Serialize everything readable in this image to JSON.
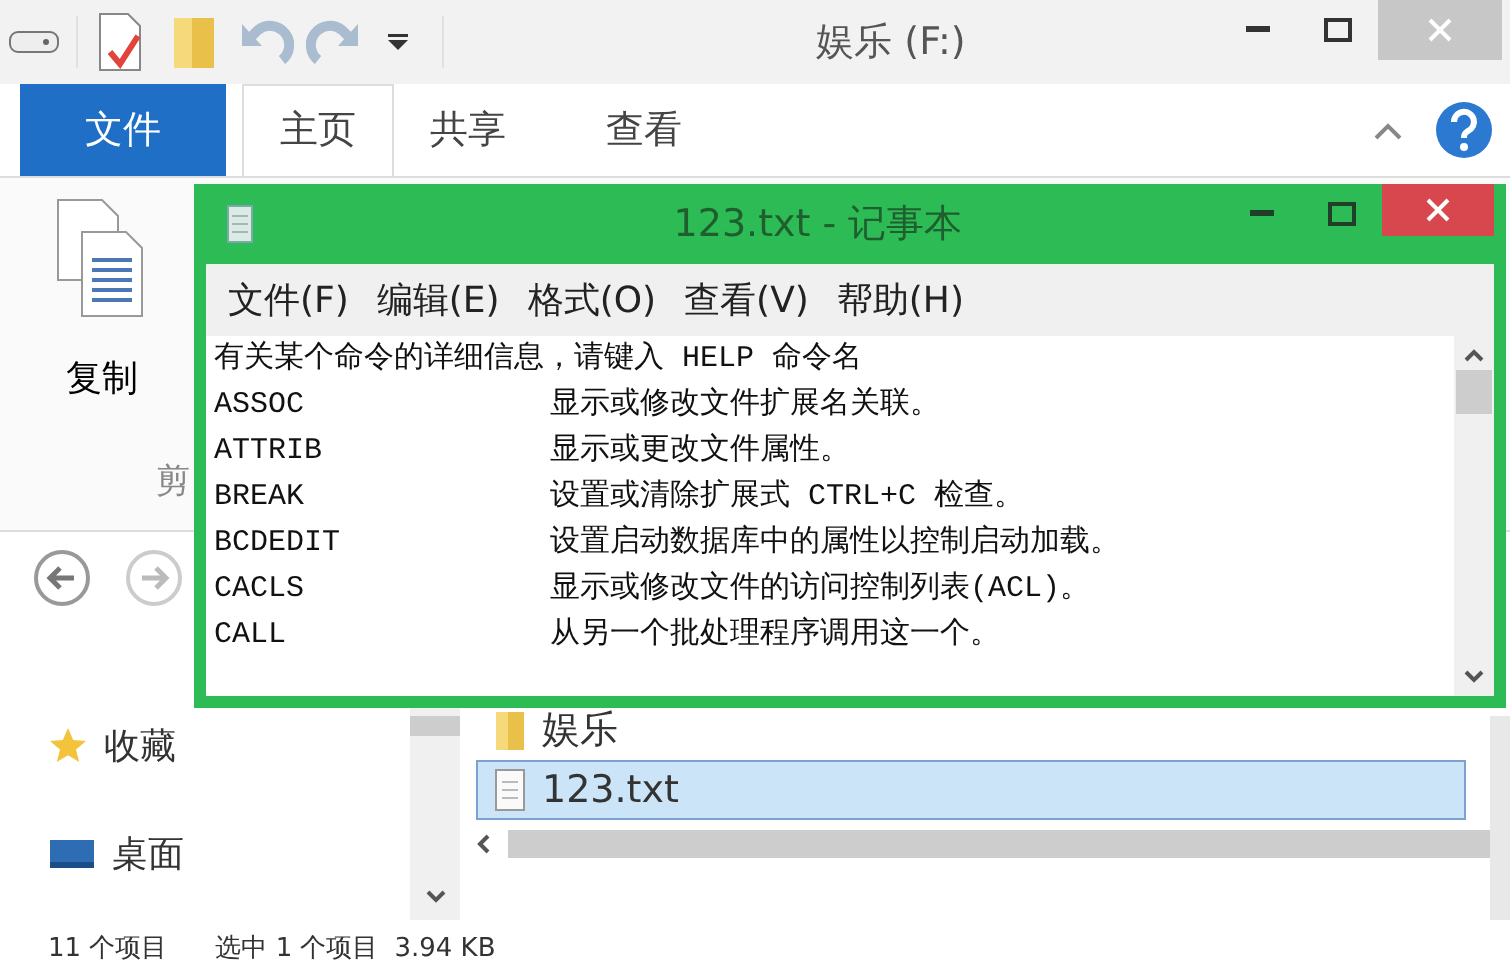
{
  "explorer": {
    "title": "娱乐 (F:)",
    "ribbon_tabs": [
      {
        "label": "文件",
        "kind": "file",
        "selected": false
      },
      {
        "label": "主页",
        "kind": "tab",
        "selected": true
      },
      {
        "label": "共享",
        "kind": "tab",
        "selected": false
      },
      {
        "label": "查看",
        "kind": "tab",
        "selected": false
      }
    ],
    "ribbon_buttons": [
      {
        "label": "复制"
      }
    ],
    "ribbon_group": "剪",
    "sidebar": [
      {
        "label": "收藏",
        "kind": "favorites"
      },
      {
        "label": "桌面",
        "kind": "desktop"
      }
    ],
    "files": [
      {
        "name": "娱乐",
        "kind": "folder",
        "selected": false
      },
      {
        "name": "123.txt",
        "kind": "text",
        "selected": true
      }
    ],
    "status_bar": {
      "item_count": "11 个项目",
      "selection": "选中 1 个项目",
      "size": "3.94 KB"
    }
  },
  "notepad": {
    "title": "123.txt - 记事本",
    "menu": [
      "文件(F)",
      "编辑(E)",
      "格式(O)",
      "查看(V)",
      "帮助(H)"
    ],
    "intro": "有关某个命令的详细信息，请键入 HELP 命令名",
    "rows": [
      {
        "command": "ASSOC",
        "description": "显示或修改文件扩展名关联。"
      },
      {
        "command": "ATTRIB",
        "description": "显示或更改文件属性。"
      },
      {
        "command": "BREAK",
        "description": "设置或清除扩展式 CTRL+C 检查。"
      },
      {
        "command": "BCDEDIT",
        "description": "设置启动数据库中的属性以控制启动加载。"
      },
      {
        "command": "CACLS",
        "description": "显示或修改文件的访问控制列表(ACL)。"
      },
      {
        "command": "CALL",
        "description": "从另一个批处理程序调用这一个。"
      }
    ]
  }
}
